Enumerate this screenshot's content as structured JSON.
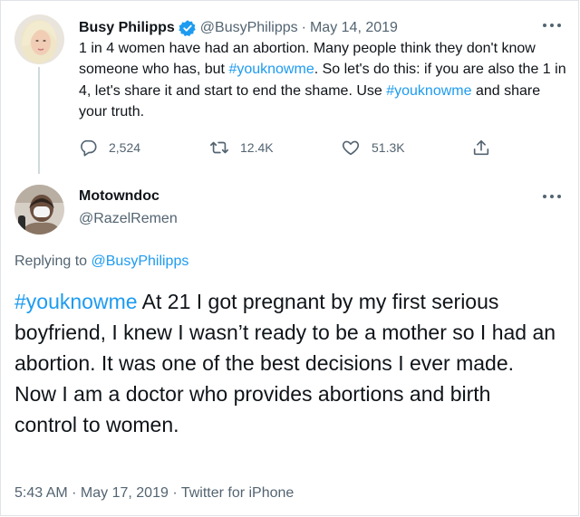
{
  "parent_tweet": {
    "display_name": "Busy Philipps",
    "handle": "@BusyPhilipps",
    "date": "May 14, 2019",
    "separator": "·",
    "text_parts": [
      "1 in 4 women have had an abortion. Many people think they don't know someone who has, but ",
      "#youknowme",
      ". So let's do this: if you are also the 1 in 4, let's share it and start to end the shame. Use ",
      "#youknowme",
      " and share your truth."
    ],
    "stats": {
      "replies": "2,524",
      "retweets": "12.4K",
      "likes": "51.3K"
    },
    "icons": [
      "verified-badge-icon",
      "more-icon",
      "reply-icon",
      "retweet-icon",
      "like-icon",
      "share-icon"
    ]
  },
  "reply_tweet": {
    "display_name": "Motowndoc",
    "handle": "@RazelRemen",
    "replying_prefix": "Replying to ",
    "replying_to": "@BusyPhilipps",
    "hashtag": "#youknowme",
    "text": " At 21 I got pregnant by my first serious boyfriend, I knew I wasn’t ready to be a mother so I had an abortion. It was one of the best decisions I ever made. Now I am a doctor who provides abortions and birth control to women.",
    "time": "5:43 AM",
    "date": "May 17, 2019",
    "source": "Twitter for iPhone",
    "separator": " · "
  },
  "colors": {
    "link": "#1d9bf0",
    "muted": "#536471",
    "text": "#0f1419",
    "border": "#dfe3e7"
  }
}
